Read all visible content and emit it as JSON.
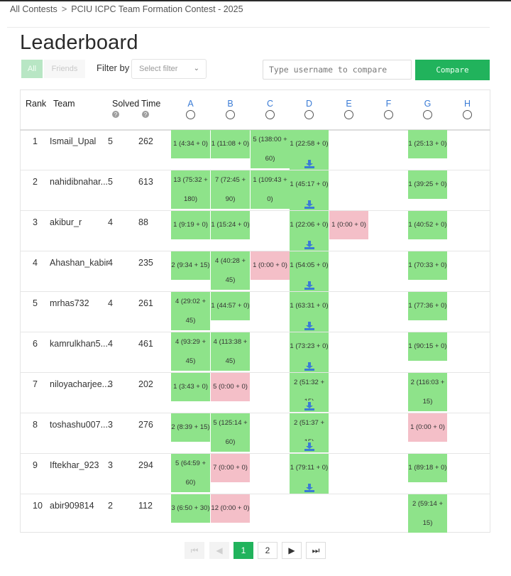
{
  "breadcrumb": {
    "root": "All Contests",
    "separator": ">",
    "current": "PCIU ICPC Team Formation Contest - 2025"
  },
  "title": "Leaderboard",
  "toggle": {
    "all": "All",
    "friends": "Friends"
  },
  "filter": {
    "label": "Filter by",
    "value": "Select filter"
  },
  "compare": {
    "placeholder": "Type username to compare",
    "button": "Compare"
  },
  "columns": {
    "rank": "Rank",
    "team": "Team",
    "solved": "Solved",
    "time": "Time",
    "help_glyph": "?"
  },
  "problems": [
    "A",
    "B",
    "C",
    "D",
    "E",
    "F",
    "G",
    "H"
  ],
  "rows": [
    {
      "rank": "1",
      "team": "Ismail_Upal",
      "solved": "5",
      "time": "262",
      "cells": [
        {
          "col": 0,
          "status": "ac",
          "lines": [
            "1 (4:34 + 0)"
          ],
          "download": false
        },
        {
          "col": 1,
          "status": "ac",
          "lines": [
            "1 (11:08 + 0)"
          ],
          "download": false
        },
        {
          "col": 2,
          "status": "ac",
          "lines": [
            "5 (138:00 +",
            "60)"
          ],
          "download": false
        },
        {
          "col": 3,
          "status": "ac",
          "lines": [
            "1 (22:58 + 0)"
          ],
          "download": true
        },
        {
          "col": 6,
          "status": "ac",
          "lines": [
            "1 (25:13 + 0)"
          ],
          "download": false
        }
      ]
    },
    {
      "rank": "2",
      "team": "nahidibnahar...",
      "solved": "5",
      "time": "613",
      "cells": [
        {
          "col": 0,
          "status": "ac",
          "lines": [
            "13 (75:32 +",
            "180)"
          ],
          "download": false
        },
        {
          "col": 1,
          "status": "ac",
          "lines": [
            "7 (72:45 +",
            "90)"
          ],
          "download": false
        },
        {
          "col": 2,
          "status": "ac",
          "lines": [
            "1 (109:43 +",
            "0)"
          ],
          "download": false
        },
        {
          "col": 3,
          "status": "ac",
          "lines": [
            "1 (45:17 + 0)"
          ],
          "download": true
        },
        {
          "col": 6,
          "status": "ac",
          "lines": [
            "1 (39:25 + 0)"
          ],
          "download": false
        }
      ]
    },
    {
      "rank": "3",
      "team": "akibur_r",
      "solved": "4",
      "time": "88",
      "cells": [
        {
          "col": 0,
          "status": "ac",
          "lines": [
            "1 (9:19 + 0)"
          ],
          "download": false
        },
        {
          "col": 1,
          "status": "ac",
          "lines": [
            "1 (15:24 + 0)"
          ],
          "download": false
        },
        {
          "col": 3,
          "status": "ac",
          "lines": [
            "1 (22:06 + 0)"
          ],
          "download": true
        },
        {
          "col": 4,
          "status": "wa",
          "lines": [
            "1 (0:00 + 0)"
          ],
          "download": false
        },
        {
          "col": 6,
          "status": "ac",
          "lines": [
            "1 (40:52 + 0)"
          ],
          "download": false
        }
      ]
    },
    {
      "rank": "4",
      "team": "Ahashan_kabir",
      "solved": "4",
      "time": "235",
      "cells": [
        {
          "col": 0,
          "status": "ac",
          "lines": [
            "2 (9:34 + 15)"
          ],
          "download": false
        },
        {
          "col": 1,
          "status": "ac",
          "lines": [
            "4 (40:28 +",
            "45)"
          ],
          "download": false
        },
        {
          "col": 2,
          "status": "wa",
          "lines": [
            "1 (0:00 + 0)"
          ],
          "download": false
        },
        {
          "col": 3,
          "status": "ac",
          "lines": [
            "1 (54:05 + 0)"
          ],
          "download": true
        },
        {
          "col": 6,
          "status": "ac",
          "lines": [
            "1 (70:33 + 0)"
          ],
          "download": false
        }
      ]
    },
    {
      "rank": "5",
      "team": "mrhas732",
      "solved": "4",
      "time": "261",
      "cells": [
        {
          "col": 0,
          "status": "ac",
          "lines": [
            "4 (29:02 +",
            "45)"
          ],
          "download": false
        },
        {
          "col": 1,
          "status": "ac",
          "lines": [
            "1 (44:57 + 0)"
          ],
          "download": false
        },
        {
          "col": 3,
          "status": "ac",
          "lines": [
            "1 (63:31 + 0)"
          ],
          "download": true
        },
        {
          "col": 6,
          "status": "ac",
          "lines": [
            "1 (77:36 + 0)"
          ],
          "download": false
        }
      ]
    },
    {
      "rank": "6",
      "team": "kamrulkhan5...",
      "solved": "4",
      "time": "461",
      "cells": [
        {
          "col": 0,
          "status": "ac",
          "lines": [
            "4 (93:29 +",
            "45)"
          ],
          "download": false
        },
        {
          "col": 1,
          "status": "ac",
          "lines": [
            "4 (113:38 +",
            "45)"
          ],
          "download": false
        },
        {
          "col": 3,
          "status": "ac",
          "lines": [
            "1 (73:23 + 0)"
          ],
          "download": true
        },
        {
          "col": 6,
          "status": "ac",
          "lines": [
            "1 (90:15 + 0)"
          ],
          "download": false
        }
      ]
    },
    {
      "rank": "7",
      "team": "niloyacharjee...",
      "solved": "3",
      "time": "202",
      "cells": [
        {
          "col": 0,
          "status": "ac",
          "lines": [
            "1 (3:43 + 0)"
          ],
          "download": false
        },
        {
          "col": 1,
          "status": "wa",
          "lines": [
            "5 (0:00 + 0)"
          ],
          "download": false
        },
        {
          "col": 3,
          "status": "ac",
          "lines": [
            "2 (51:32 +",
            "15)"
          ],
          "download": true
        },
        {
          "col": 6,
          "status": "ac",
          "lines": [
            "2 (116:03 +",
            "15)"
          ],
          "download": false
        }
      ]
    },
    {
      "rank": "8",
      "team": "toshashu007...",
      "solved": "3",
      "time": "276",
      "cells": [
        {
          "col": 0,
          "status": "ac",
          "lines": [
            "2 (8:39 + 15)"
          ],
          "download": false
        },
        {
          "col": 1,
          "status": "ac",
          "lines": [
            "5 (125:14 +",
            "60)"
          ],
          "download": false
        },
        {
          "col": 3,
          "status": "ac",
          "lines": [
            "2 (51:37 +",
            "15)"
          ],
          "download": true
        },
        {
          "col": 6,
          "status": "wa",
          "lines": [
            "1 (0:00 + 0)"
          ],
          "download": false
        }
      ]
    },
    {
      "rank": "9",
      "team": "Iftekhar_923",
      "solved": "3",
      "time": "294",
      "cells": [
        {
          "col": 0,
          "status": "ac",
          "lines": [
            "5 (64:59 +",
            "60)"
          ],
          "download": false
        },
        {
          "col": 1,
          "status": "wa",
          "lines": [
            "7 (0:00 + 0)"
          ],
          "download": false
        },
        {
          "col": 3,
          "status": "ac",
          "lines": [
            "1 (79:11 + 0)"
          ],
          "download": true
        },
        {
          "col": 6,
          "status": "ac",
          "lines": [
            "1 (89:18 + 0)"
          ],
          "download": false
        }
      ]
    },
    {
      "rank": "10",
      "team": "abir909814",
      "solved": "2",
      "time": "112",
      "cells": [
        {
          "col": 0,
          "status": "ac",
          "lines": [
            "3 (6:50 + 30)"
          ],
          "download": false
        },
        {
          "col": 1,
          "status": "wa",
          "lines": [
            "12 (0:00 + 0)"
          ],
          "download": false
        },
        {
          "col": 6,
          "status": "ac",
          "lines": [
            "2 (59:14 +",
            "15)"
          ],
          "download": false
        }
      ]
    }
  ],
  "pagination": {
    "first": "⏮",
    "prev": "◀",
    "pages": [
      "1",
      "2"
    ],
    "current_page": "1",
    "next": "▶",
    "last": "⏭"
  },
  "colors": {
    "accepted": "#8ee38a",
    "wrong": "#f4bfc8",
    "primary": "#21b35c",
    "problem_link": "#3a7bd5",
    "download_icon": "#3a7bd5"
  },
  "icons": {
    "download": "download-icon",
    "help": "help-circle-icon",
    "dropdown": "chevron-down-icon",
    "separator": "chevron-right-icon"
  }
}
